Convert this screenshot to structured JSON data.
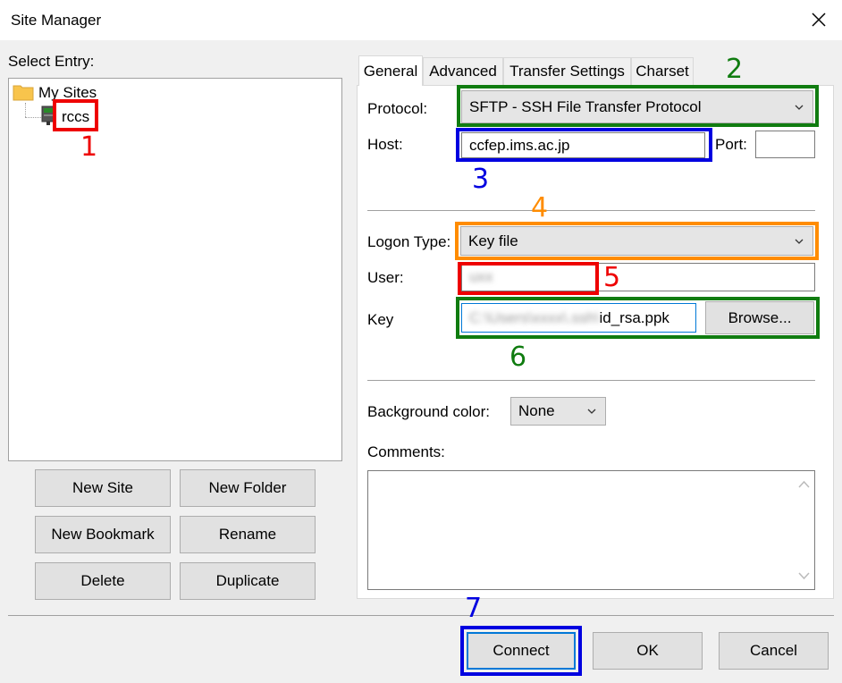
{
  "window": {
    "title": "Site Manager"
  },
  "left": {
    "select_entry_label": "Select Entry:",
    "tree": {
      "root_label": "My Sites",
      "site_label": "rccs"
    },
    "buttons": {
      "new_site": "New Site",
      "new_folder": "New Folder",
      "new_bookmark": "New Bookmark",
      "rename": "Rename",
      "delete": "Delete",
      "duplicate": "Duplicate"
    }
  },
  "tabs": [
    "General",
    "Advanced",
    "Transfer Settings",
    "Charset"
  ],
  "general": {
    "protocol_label": "Protocol:",
    "protocol_value": "SFTP - SSH File Transfer Protocol",
    "host_label": "Host:",
    "host_value": "ccfep.ims.ac.jp",
    "port_label": "Port:",
    "port_value": "",
    "logon_type_label": "Logon Type:",
    "logon_type_value": "Key file",
    "user_label": "User:",
    "user_value_blurred": "uxx",
    "key_label": "Key",
    "key_value_blurred": "C:\\Users\\xxxx\\.ssh\\",
    "key_value_suffix": "id_rsa.ppk",
    "browse_label": "Browse...",
    "bg_color_label": "Background color:",
    "bg_color_value": "None",
    "comments_label": "Comments:",
    "comments_value": ""
  },
  "footer": {
    "connect": "Connect",
    "ok": "OK",
    "cancel": "Cancel"
  },
  "annotations": {
    "n1": "1",
    "n2": "2",
    "n3": "3",
    "n4": "4",
    "n5": "5",
    "n6": "6",
    "n7": "7"
  },
  "colors": {
    "red": "#ee0000",
    "green": "#107c10",
    "blue": "#0000e0",
    "orange": "#ff8c00",
    "folder": "#f8c44c"
  }
}
